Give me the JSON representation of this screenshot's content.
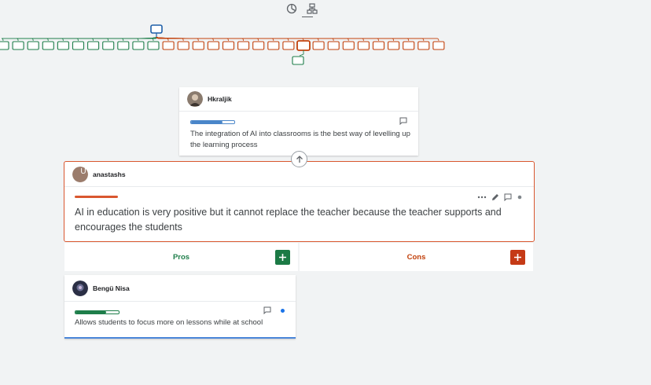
{
  "toolbar": {
    "icons": [
      "stats-icon",
      "tree-layout-icon"
    ],
    "active": "tree-layout-icon"
  },
  "colors": {
    "pro": "#1e7e4a",
    "con": "#c2410c",
    "focus_border": "#d9572f",
    "selected_node": "#1f5fa8",
    "add_pro_button": "#1b7a45",
    "add_con_button": "#c53a16"
  },
  "parent_argument": {
    "author": "Hkraljik",
    "text": "The integration of AI into classrooms is the best way of levelling up the learning process",
    "impact_bar": {
      "color": "#4a86c9",
      "fill": 0.72
    }
  },
  "focus_argument": {
    "author": "anastashs",
    "avatar_letter": "U",
    "text": "AI in education is very positive but it cannot replace the teacher because the teacher supports and encourages the students",
    "impact_bar": {
      "color": "#d9572f",
      "fill": 0.98
    }
  },
  "columns": {
    "pros_label": "Pros",
    "cons_label": "Cons"
  },
  "pros": [
    {
      "author": "Bengü Nisa",
      "text": "Allows students to focus more on lessons while at school",
      "impact_bar": {
        "color": "#1e7e4a",
        "fill": 0.7
      }
    }
  ],
  "tree_map": {
    "green_left_count": 11,
    "red_right_count": 19,
    "top_node": "selected",
    "child_node": "green"
  }
}
